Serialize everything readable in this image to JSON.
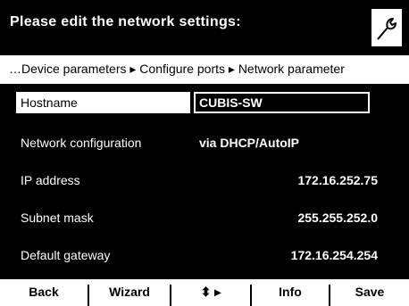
{
  "header": {
    "title": "Please edit the network settings:",
    "tool_icon": "wrench-icon"
  },
  "breadcrumb": {
    "text": "…Device parameters ▸ Configure ports ▸ Network parameter"
  },
  "fields": [
    {
      "label": "Hostname",
      "value": "CUBIS-SW"
    },
    {
      "label": "Network configuration",
      "value": "via DHCP/AutoIP"
    },
    {
      "label": "IP address",
      "value": "172.16.252.75"
    },
    {
      "label": "Subnet mask",
      "value": "255.255.252.0"
    },
    {
      "label": "Default gateway",
      "value": "172.16.254.254"
    }
  ],
  "softkeys": [
    {
      "label": "Back"
    },
    {
      "label": "Wizard"
    },
    {
      "label": "⬍ ▸"
    },
    {
      "label": "Info"
    },
    {
      "label": "Save"
    }
  ]
}
